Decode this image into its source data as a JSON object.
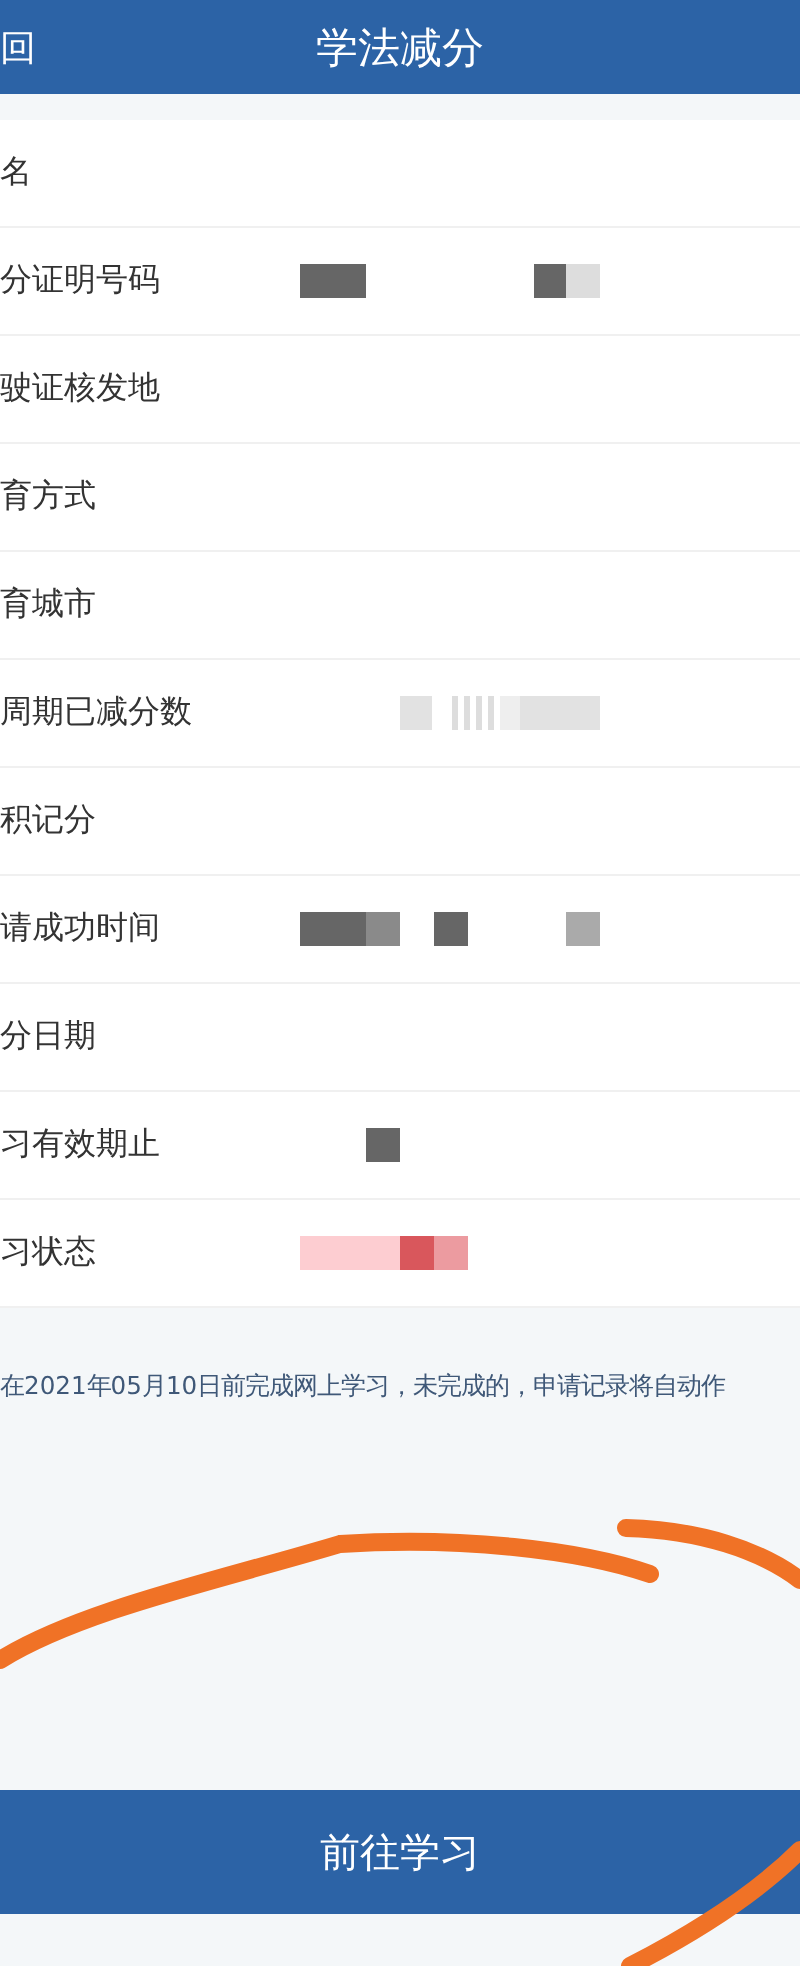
{
  "header": {
    "back": "回",
    "title": "学法减分"
  },
  "rows": [
    {
      "label": "名",
      "kind": "plain"
    },
    {
      "label": "分证明号码",
      "kind": "id"
    },
    {
      "label": "驶证核发地",
      "kind": "plain"
    },
    {
      "label": "育方式",
      "kind": "plain"
    },
    {
      "label": "育城市",
      "kind": "plain"
    },
    {
      "label": "周期已减分数",
      "kind": "faint"
    },
    {
      "label": "积记分",
      "kind": "plain"
    },
    {
      "label": "请成功时间",
      "kind": "time"
    },
    {
      "label": "分日期",
      "kind": "plain"
    },
    {
      "label": "习有效期止",
      "kind": "date"
    },
    {
      "label": "习状态",
      "kind": "status"
    }
  ],
  "notice": "在2021年05月10日前完成网上学习，未完成的，申请记录将自动作",
  "button": "前往学习"
}
